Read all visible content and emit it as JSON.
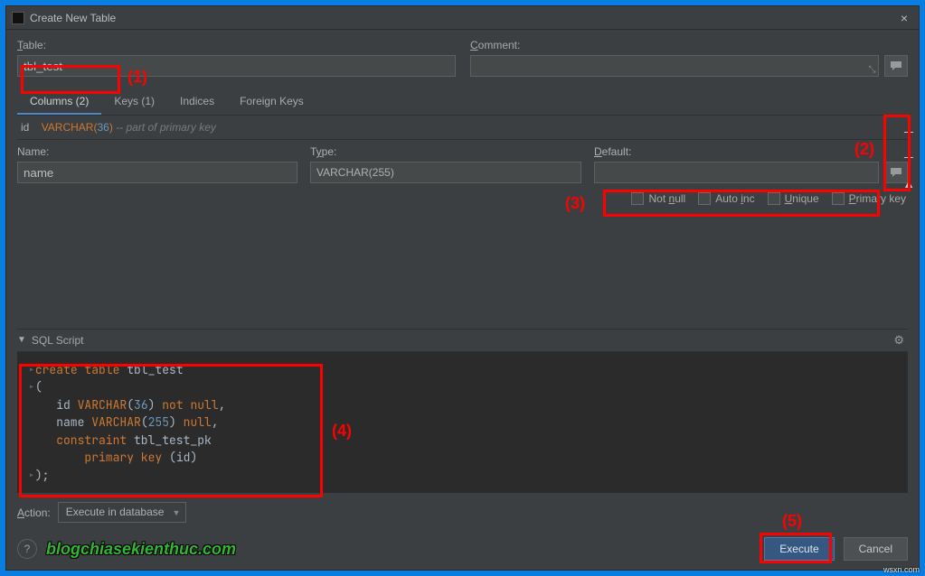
{
  "window": {
    "title": "Create New Table"
  },
  "labels": {
    "table": "Table:",
    "comment": "Comment:",
    "name": "Name:",
    "type": "Type:",
    "default": "Default:",
    "action": "Action:",
    "sql_script": "SQL Script"
  },
  "table_name": "tbl_test",
  "tabs": [
    {
      "label": "Columns (2)",
      "active": true
    },
    {
      "label": "Keys (1)",
      "active": false
    },
    {
      "label": "Indices",
      "active": false
    },
    {
      "label": "Foreign Keys",
      "active": false
    }
  ],
  "column_summary": {
    "name": "id",
    "type_kw": "VARCHAR(",
    "type_num": "36",
    "type_close": ")",
    "comment": " -- part of primary key"
  },
  "field": {
    "name": "name",
    "type_kw": "VARCHAR(",
    "type_num": "255",
    "type_close": ")"
  },
  "checks": {
    "not_null": "Not null",
    "auto_inc": "Auto inc",
    "unique": "Unique",
    "primary_key": "Primary key"
  },
  "action_dropdown": "Execute in database",
  "buttons": {
    "execute": "Execute",
    "cancel": "Cancel"
  },
  "sql": {
    "l1_kw1": "create table",
    "l1_ident": " tbl_test",
    "l2": "(",
    "l3_ident": "    id ",
    "l3_type": "VARCHAR",
    "l3_paren_o": "(",
    "l3_num": "36",
    "l3_paren_c": ")",
    "l3_kw": " not null",
    "l3_comma": ",",
    "l4_ident": "    name ",
    "l4_type": "VARCHAR",
    "l4_paren_o": "(",
    "l4_num": "255",
    "l4_paren_c": ")",
    "l4_kw": " null",
    "l4_comma": ",",
    "l5_kw": "    constraint",
    "l5_ident": " tbl_test_pk",
    "l6_kw": "        primary key ",
    "l6_paren_o": "(",
    "l6_ident": "id",
    "l6_paren_c": ")",
    "l7": ");"
  },
  "annotations": {
    "a1": "(1)",
    "a2": "(2)",
    "a3": "(3)",
    "a4": "(4)",
    "a5": "(5)"
  },
  "watermark": "blogchiasekienthuc.com",
  "corner_text": "wsxn.com"
}
